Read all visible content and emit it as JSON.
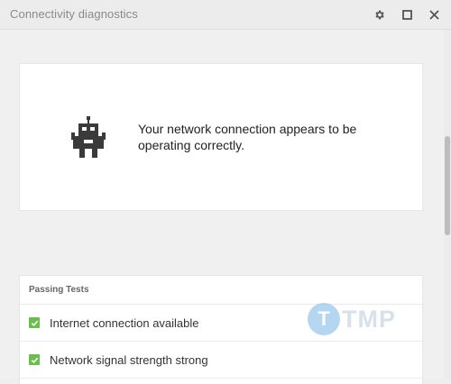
{
  "window": {
    "title": "Connectivity diagnostics"
  },
  "titlebar_buttons": [
    {
      "name": "settings",
      "icon": "gear-icon"
    },
    {
      "name": "maximize",
      "icon": "maximize-icon"
    },
    {
      "name": "close",
      "icon": "close-icon"
    }
  ],
  "status": {
    "message": "Your network connection appears to be operating correctly.",
    "icon": "robot-icon"
  },
  "passing_tests": {
    "header": "Passing Tests",
    "items": [
      {
        "label": "Internet connection available",
        "checked": true
      },
      {
        "label": "Network signal strength strong",
        "checked": true
      }
    ]
  },
  "watermark": {
    "letter": "T",
    "text": "TMP"
  },
  "colors": {
    "check_green": "#6abf4b",
    "title_text": "#8a8a8a"
  }
}
